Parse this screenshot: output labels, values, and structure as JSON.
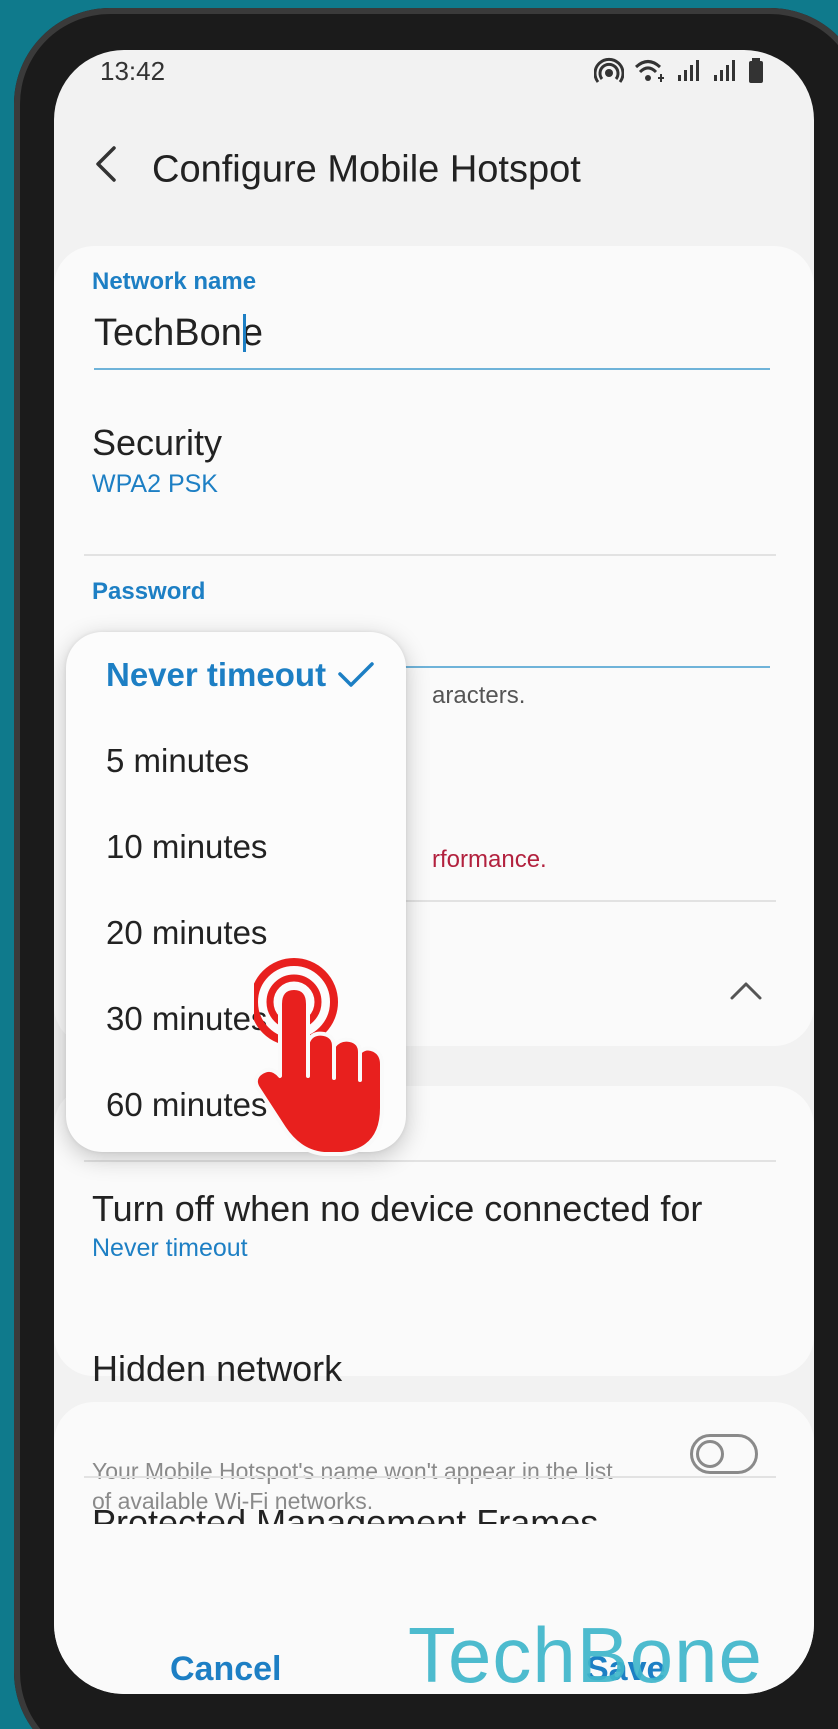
{
  "status_bar": {
    "time": "13:42"
  },
  "header": {
    "title": "Configure Mobile Hotspot"
  },
  "network_name": {
    "label": "Network name",
    "value": "TechBone"
  },
  "security": {
    "title": "Security",
    "value": "WPA2 PSK"
  },
  "password": {
    "label": "Password",
    "hint_partial": "aracters.",
    "warning_partial": "rformance."
  },
  "turn_off": {
    "title": "Turn off when no device connected for",
    "value": "Never timeout"
  },
  "hidden_network": {
    "title": "Hidden network",
    "description": "Your Mobile Hotspot's name won't appear in the list of available Wi-Fi networks.",
    "enabled": false
  },
  "pmf": {
    "title": "Protected Management Frames"
  },
  "dropdown": {
    "options": [
      {
        "label": "Never timeout",
        "selected": true
      },
      {
        "label": "5 minutes",
        "selected": false
      },
      {
        "label": "10 minutes",
        "selected": false
      },
      {
        "label": "20 minutes",
        "selected": false
      },
      {
        "label": "30 minutes",
        "selected": false
      },
      {
        "label": "60 minutes",
        "selected": false
      }
    ]
  },
  "buttons": {
    "cancel": "Cancel",
    "save": "Save"
  },
  "watermark": "TechBone",
  "colors": {
    "accent": "#1d7fc4",
    "warning": "#b2213e",
    "background": "#0f7a8c",
    "tap_hand": "#e8201e"
  }
}
